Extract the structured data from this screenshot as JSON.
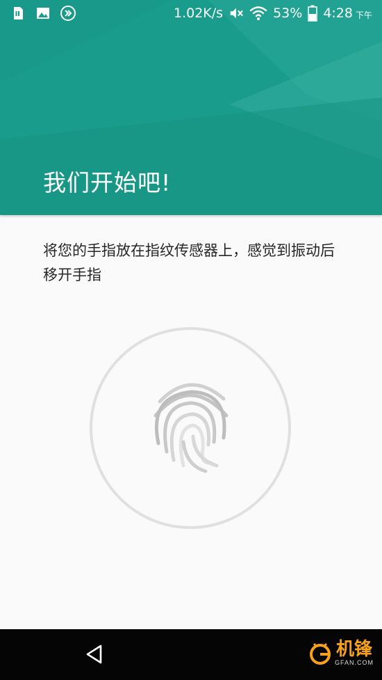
{
  "status_bar": {
    "icons_left": [
      "sim-card-icon",
      "image-icon",
      "double-chevron-icon"
    ],
    "network_speed": "1.02K/s",
    "mute_icon": "mute-icon",
    "wifi_icon": "wifi-icon",
    "battery_percent": "53%",
    "battery_level": 0.53,
    "battery_icon": "battery-icon",
    "time": "4:28",
    "ampm": "下午"
  },
  "header": {
    "title": "我们开始吧!",
    "color": "#1a9c8c"
  },
  "instruction": {
    "text": "将您的手指放在指纹传感器上，感觉到振动后移开手指"
  },
  "sensor": {
    "ring_icon": "sensor-ring-icon",
    "fingerprint_icon": "fingerprint-icon"
  },
  "nav_bar": {
    "back_icon": "back-triangle-icon"
  },
  "watermark": {
    "logo_icon": "gfan-logo-icon",
    "text": "机锋",
    "sub": "GFAN.COM",
    "color": "#f7a11a"
  }
}
